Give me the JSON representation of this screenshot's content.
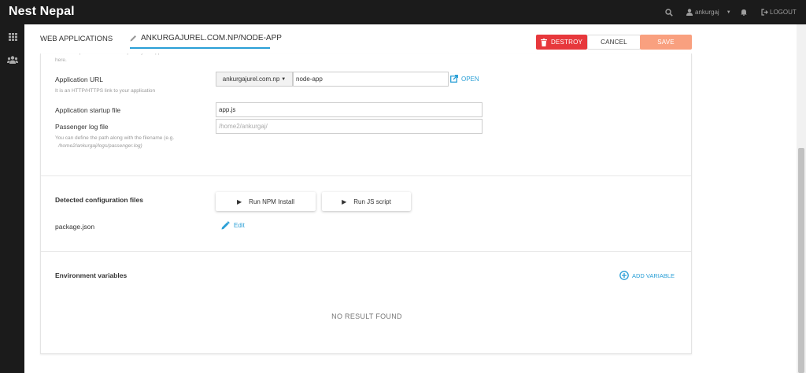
{
  "topbar": {
    "brand": "Nest Nepal",
    "user": "ankurgaj",
    "logout": "LOGOUT"
  },
  "icons": {
    "search": "search-icon",
    "user": "user-icon",
    "caret": "caret-down-icon",
    "bell": "bell-icon",
    "logout": "logout-icon",
    "apps": "grid-icon",
    "users": "users-icon"
  },
  "breadcrumb": {
    "root": "WEB APPLICATIONS",
    "current": "ANKURGAJUREL.COM.NP/NODE-APP"
  },
  "actions": {
    "destroy": "DESTROY",
    "cancel": "CANCEL",
    "save": "SAVE"
  },
  "form": {
    "top_hint": "that corresponds with its URI. Upload your application files here.",
    "app_url_label": "Application URL",
    "app_url_hint": "It is an HTTP/HTTPS link to your application",
    "domain_value": "ankurgajurel.com.np",
    "path_value": "node-app",
    "open_label": "OPEN",
    "startup_label": "Application startup file",
    "startup_value": "app.js",
    "log_label": "Passenger log file",
    "log_placeholder": "/home2/ankurgaj/",
    "log_hint": "You can define the path along with the filename (e.g.",
    "log_hint_example": "/home2/ankurgaj/logs/passenger.log)"
  },
  "config": {
    "title": "Detected configuration files",
    "npm_install": "Run NPM Install",
    "js_script": "Run JS script",
    "file": "package.json",
    "edit": "Edit"
  },
  "env": {
    "title": "Environment variables",
    "add": "ADD VARIABLE",
    "empty": "NO RESULT FOUND"
  },
  "colors": {
    "accent": "#2a9fd6",
    "destroy": "#e7383c",
    "save": "#f9a07f",
    "topbar": "#1b1b1b"
  }
}
